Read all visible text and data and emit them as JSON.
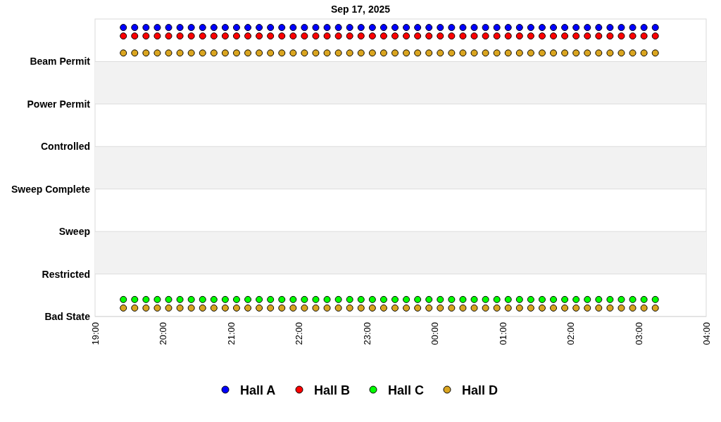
{
  "chart": {
    "title": "Sep 17, 2025",
    "y_axis_labels": [
      "Beam Permit",
      "Power Permit",
      "Controlled",
      "Sweep Complete",
      "Sweep",
      "Restricted",
      "Bad State"
    ],
    "x_axis_labels": [
      "19:00",
      "20:00",
      "21:00",
      "22:00",
      "23:00",
      "00:00",
      "01:00",
      "02:00",
      "03:00",
      "04:00"
    ],
    "legend": [
      {
        "name": "Hall A",
        "color": "#0000ff"
      },
      {
        "name": "Hall B",
        "color": "#ff0000"
      },
      {
        "name": "Hall C",
        "color": "#00ff00"
      },
      {
        "name": "Hall D",
        "color": "#daa520"
      }
    ]
  }
}
